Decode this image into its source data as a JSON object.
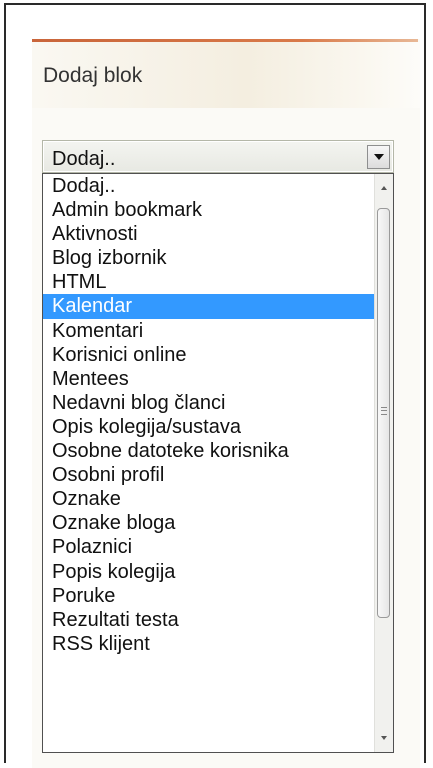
{
  "block": {
    "title": "Dodaj blok"
  },
  "select": {
    "value": "Dodaj.."
  },
  "listbox": {
    "selected_index": 5,
    "options": [
      "Dodaj..",
      "Admin bookmark",
      "Aktivnosti",
      "Blog izbornik",
      "HTML",
      "Kalendar",
      "Komentari",
      "Korisnici online",
      "Mentees",
      "Nedavni blog članci",
      "Opis kolegija/sustava",
      "Osobne datoteke korisnika",
      "Osobni profil",
      "Oznake",
      "Oznake bloga",
      "Polaznici",
      "Popis kolegija",
      "Poruke",
      "Rezultati testa",
      "RSS klijent"
    ]
  },
  "colors": {
    "accent_line": "#c9653a",
    "selected_bg": "#3399ff"
  },
  "icons": {
    "dropdown": "chevron-down-icon",
    "scroll_up": "scroll-up-arrow-icon",
    "scroll_down": "scroll-down-arrow-icon"
  }
}
